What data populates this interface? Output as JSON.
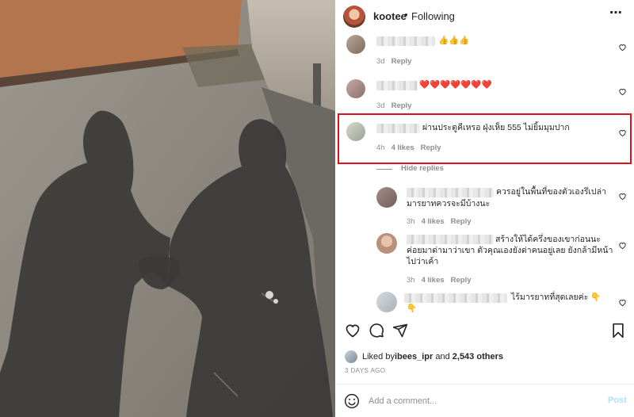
{
  "header": {
    "username": "kootee",
    "separator": "•",
    "follow_status": "Following",
    "more_label": "⋯"
  },
  "comments": [
    {
      "emojis": "👍👍👍",
      "time": "3d",
      "reply": "Reply"
    },
    {
      "emojis": "❤️❤️❤️❤️❤️❤️❤️",
      "time": "3d",
      "reply": "Reply"
    },
    {
      "text": "ผ่านประตูคีเหรอ ฝุ่งเห็ย 555 ไม่ยิ้มมุมปาก",
      "time": "4h",
      "likes": "4 likes",
      "reply": "Reply"
    }
  ],
  "hide_replies": "Hide replies",
  "replies": [
    {
      "line1": "ควรอยู่ในพื้นที่ของตัวเองรึเปล่า",
      "line2": "มารยาทควรจะมีบ้างนะ",
      "time": "3h",
      "likes": "4 likes",
      "reply": "Reply"
    },
    {
      "line1": "สร้างให้ได้ครึ่งของเขาก่อนนะ",
      "line2": "ค่อยมาด่ามาว่าเขา ตัวคุณเองยังด่าคนอยู่เลย ยังกล้ามีหน้า",
      "line3": "ไปว่าเค้า",
      "time": "3h",
      "likes": "4 likes",
      "reply": "Reply"
    },
    {
      "line1": "ไร้มารยาทที่สุดเลยค่ะ 👇",
      "line2": "👇"
    }
  ],
  "likes": {
    "prefix": "Liked by ",
    "user": "ibees_ipr",
    "middle": " and ",
    "count": "2,543 others"
  },
  "date": "3 DAYS AGO",
  "add_comment": {
    "placeholder": "Add a comment...",
    "post_label": "Post"
  },
  "colors": {
    "highlight_box": "#e0101e",
    "post_button": "#b2dffc",
    "meta_text": "#8e8e8e"
  }
}
